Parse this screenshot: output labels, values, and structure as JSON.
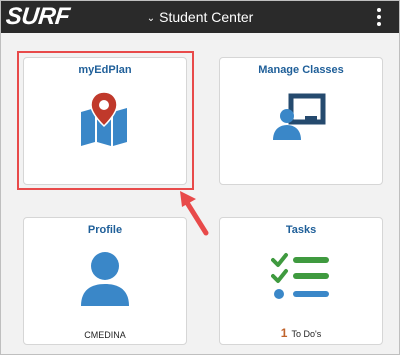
{
  "header": {
    "logo_text": "SURF",
    "nav_title": "Student Center",
    "chevron_icon": "chevron-down-icon",
    "menu_icon": "kebab-menu-icon"
  },
  "tiles": [
    {
      "title": "myEdPlan",
      "icon": "map-pin-icon",
      "footer": ""
    },
    {
      "title": "Manage Classes",
      "icon": "teacher-board-icon",
      "footer": ""
    },
    {
      "title": "Profile",
      "icon": "user-icon",
      "footer": "CMEDINA"
    },
    {
      "title": "Tasks",
      "icon": "task-list-icon",
      "footer_count": "1",
      "footer_label": "To Do's"
    }
  ],
  "colors": {
    "header_bg": "#2a2a2a",
    "tile_title": "#1f5f99",
    "icon_blue": "#3a87c8",
    "icon_dark": "#254a6e",
    "pin_red": "#c0392b",
    "check_green": "#3f9a3f",
    "highlight_red": "#e84a4a",
    "count_orange": "#c0632b"
  },
  "annotation": {
    "highlight_target": "myEdPlan",
    "arrow_icon": "pointer-arrow-icon"
  }
}
